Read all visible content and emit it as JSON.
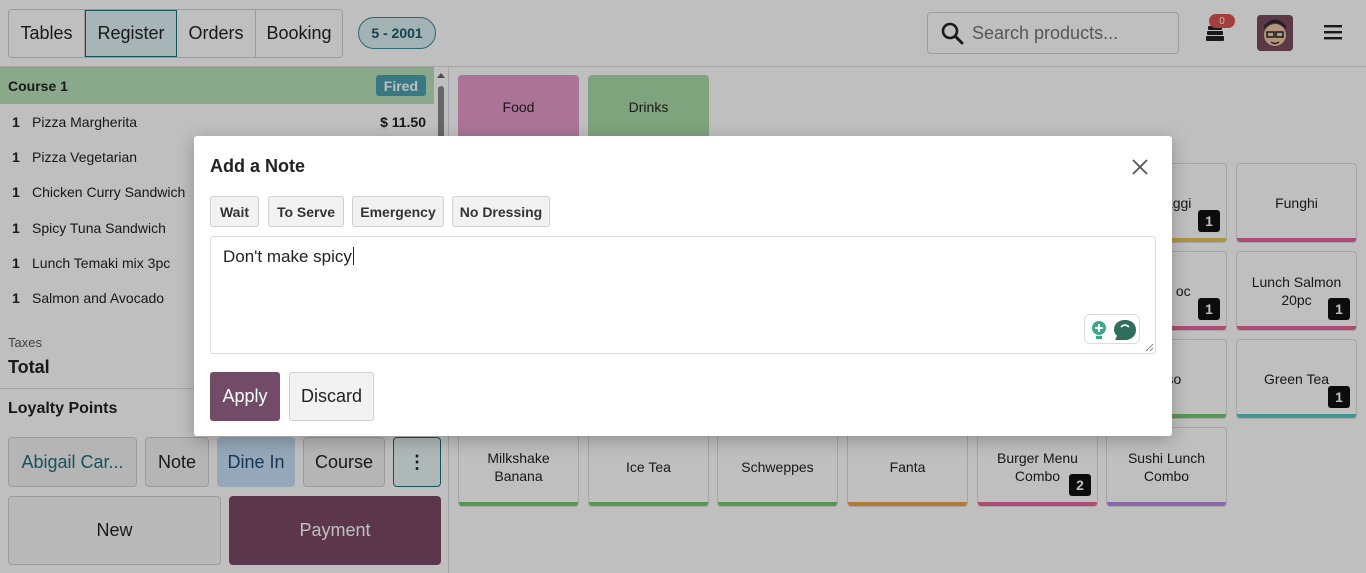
{
  "topbar": {
    "nav": [
      "Tables",
      "Register",
      "Orders",
      "Booking"
    ],
    "active_nav": "Register",
    "table_badge": "5 - 2001",
    "search_placeholder": "Search products...",
    "notification_count": "0",
    "icons": {
      "search": "search-icon",
      "notifications": "stack-icon",
      "menu": "hamburger-icon"
    }
  },
  "order": {
    "course_label": "Course 1",
    "course_status": "Fired",
    "lines": [
      {
        "qty": "1",
        "name": "Pizza Margherita",
        "price": "$ 11.50"
      },
      {
        "qty": "1",
        "name": "Pizza Vegetarian",
        "price": ""
      },
      {
        "qty": "1",
        "name": "Chicken Curry Sandwich",
        "price": ""
      },
      {
        "qty": "1",
        "name": "Spicy Tuna Sandwich",
        "price": ""
      },
      {
        "qty": "1",
        "name": "Lunch Temaki mix 3pc",
        "price": ""
      },
      {
        "qty": "1",
        "name": "Salmon and Avocado",
        "price": ""
      }
    ],
    "taxes_label": "Taxes",
    "total_label": "Total",
    "loyalty_label": "Loyalty Points"
  },
  "actions": {
    "customer": "Abigail Car...",
    "note": "Note",
    "dine_in": "Dine In",
    "course": "Course",
    "more": "⋮",
    "new": "New",
    "payment": "Payment"
  },
  "products": {
    "categories": [
      {
        "label": "Food",
        "color": "#e59bc9"
      },
      {
        "label": "Drinks",
        "color": "#a9dba7"
      }
    ],
    "cards": [
      {
        "label": "a 4 aggi",
        "count": "1",
        "bar": "#e6c45a"
      },
      {
        "label": "Funghi",
        "count": "",
        "bar": "#e8659b"
      },
      {
        "label": "Maki oc",
        "count": "1",
        "bar": "#e8659b"
      },
      {
        "label": "Lunch Salmon 20pc",
        "count": "1",
        "bar": "#e8659b"
      },
      {
        "label": "esso",
        "count": "",
        "bar": "#77c776"
      },
      {
        "label": "Green Tea",
        "count": "1",
        "bar": "#5ac7c0"
      },
      {
        "label": "Milkshake Banana",
        "count": "",
        "bar": "#77c776"
      },
      {
        "label": "Ice Tea",
        "count": "",
        "bar": "#77c776"
      },
      {
        "label": "Schweppes",
        "count": "",
        "bar": "#77c776"
      },
      {
        "label": "Fanta",
        "count": "",
        "bar": "#f0a24a"
      },
      {
        "label": "Burger Menu Combo",
        "count": "2",
        "bar": "#e8659b"
      },
      {
        "label": "Sushi Lunch Combo",
        "count": "",
        "bar": "#b48de0"
      }
    ]
  },
  "dialog": {
    "title": "Add a Note",
    "chips": [
      "Wait",
      "To Serve",
      "Emergency",
      "No Dressing"
    ],
    "note_value": "Don't make spicy",
    "apply": "Apply",
    "discard": "Discard"
  },
  "colors": {
    "primary": "#714b67",
    "accent": "#1d6f7a"
  }
}
